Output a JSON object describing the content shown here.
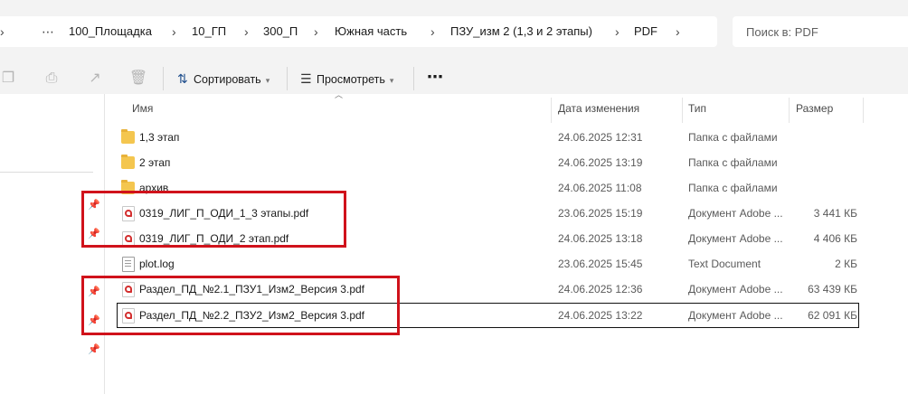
{
  "address": {
    "more": "⋯",
    "crumbs": [
      "100_Площадка",
      "10_ГП",
      "300_П",
      "Южная часть",
      "ПЗУ_изм 2 (1,3 и 2 этапы)",
      "PDF"
    ]
  },
  "search": {
    "placeholder": "Поиск в: PDF"
  },
  "toolbar": {
    "sort_label": "Сортировать",
    "view_label": "Просмотреть",
    "more": "⋯"
  },
  "columns": {
    "name": "Имя",
    "date": "Дата изменения",
    "type": "Тип",
    "size": "Размер"
  },
  "files": [
    {
      "name": "1,3 этап",
      "date": "24.06.2025 12:31",
      "type": "Папка с файлами",
      "size": "",
      "icon": "folder-icon"
    },
    {
      "name": "2 этап",
      "date": "24.06.2025 13:19",
      "type": "Папка с файлами",
      "size": "",
      "icon": "folder-icon"
    },
    {
      "name": "архив",
      "date": "24.06.2025 11:08",
      "type": "Папка с файлами",
      "size": "",
      "icon": "folder-icon"
    },
    {
      "name": "0319_ЛИГ_П_ОДИ_1_3 этапы.pdf",
      "date": "23.06.2025 15:19",
      "type": "Документ Adobe ...",
      "size": "3 441 КБ",
      "icon": "pdf-icon"
    },
    {
      "name": "0319_ЛИГ_П_ОДИ_2 этап.pdf",
      "date": "24.06.2025 13:18",
      "type": "Документ Adobe ...",
      "size": "4 406 КБ",
      "icon": "pdf-icon"
    },
    {
      "name": "plot.log",
      "date": "23.06.2025 15:45",
      "type": "Text Document",
      "size": "2 КБ",
      "icon": "text-file-icon"
    },
    {
      "name": "Раздел_ПД_№2.1_ПЗУ1_Изм2_Версия 3.pdf",
      "date": "24.06.2025 12:36",
      "type": "Документ Adobe ...",
      "size": "63 439 КБ",
      "icon": "pdf-icon"
    },
    {
      "name": "Раздел_ПД_№2.2_ПЗУ2_Изм2_Версия 3.pdf",
      "date": "24.06.2025 13:22",
      "type": "Документ Adobe ...",
      "size": "62 091 КБ",
      "icon": "pdf-icon"
    }
  ],
  "colors": {
    "highlight": "#d0121b",
    "folder": "#f4c64f",
    "pdf": "#d32f2f"
  }
}
